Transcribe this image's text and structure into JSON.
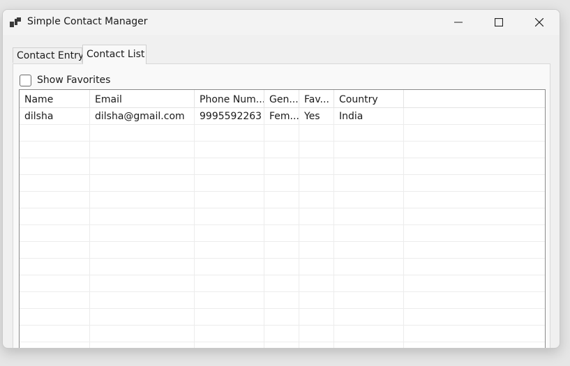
{
  "window": {
    "title": "Simple Contact Manager",
    "icons": {
      "app": "app-icon",
      "minimize": "minimize-icon",
      "maximize": "maximize-icon",
      "close": "close-icon"
    }
  },
  "tabs": [
    {
      "label": "Contact Entry",
      "selected": false
    },
    {
      "label": "Contact List",
      "selected": true
    }
  ],
  "filter": {
    "show_favorites_label": "Show Favorites",
    "show_favorites_checked": false
  },
  "grid": {
    "columns": [
      "Name",
      "Email",
      "Phone Num...",
      "Gen...",
      "Fav...",
      "Country"
    ],
    "rows": [
      [
        "dilsha",
        "dilsha@gmail.com",
        "9995592263",
        "Fem...",
        "Yes",
        "India"
      ]
    ]
  }
}
